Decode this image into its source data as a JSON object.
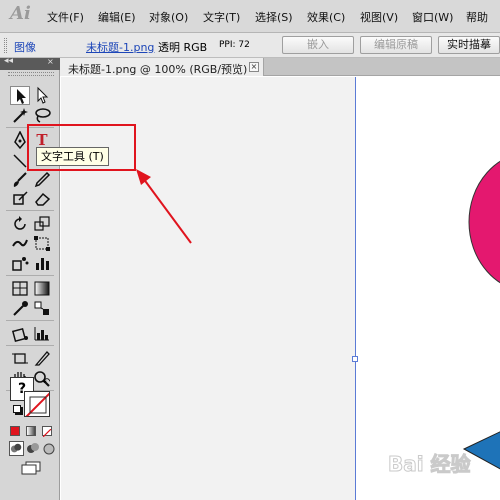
{
  "app": {
    "logo": "Ai"
  },
  "menu": [
    {
      "label": "文件(F)"
    },
    {
      "label": "编辑(E)"
    },
    {
      "label": "对象(O)"
    },
    {
      "label": "文字(T)"
    },
    {
      "label": "选择(S)"
    },
    {
      "label": "效果(C)"
    },
    {
      "label": "视图(V)"
    },
    {
      "label": "窗口(W)"
    },
    {
      "label": "帮助"
    }
  ],
  "control_bar": {
    "object_type": "图像",
    "file_name": "未标题-1.png",
    "mode": "透明 RGB",
    "ppi": "PPI: 72",
    "embed_button": "嵌入",
    "edit_original_button": "编辑原稿",
    "live_trace_button": "实时描摹"
  },
  "document": {
    "tab_title": "未标题-1.png @ 100% (RGB/预览)",
    "close_glyph": "×"
  },
  "tools": {
    "collapse_glyph": "◂◂",
    "close_glyph": "×",
    "type_tool_glyph": "T",
    "help_glyph": "?",
    "tooltip": "文字工具 (T)"
  },
  "colors": {
    "pink_circle": "#e4186f",
    "blue_shape": "#1e73b8",
    "annotation_red": "#e0141e",
    "artboard_edge": "#5b7bd6"
  },
  "watermark": "Bai 经验"
}
